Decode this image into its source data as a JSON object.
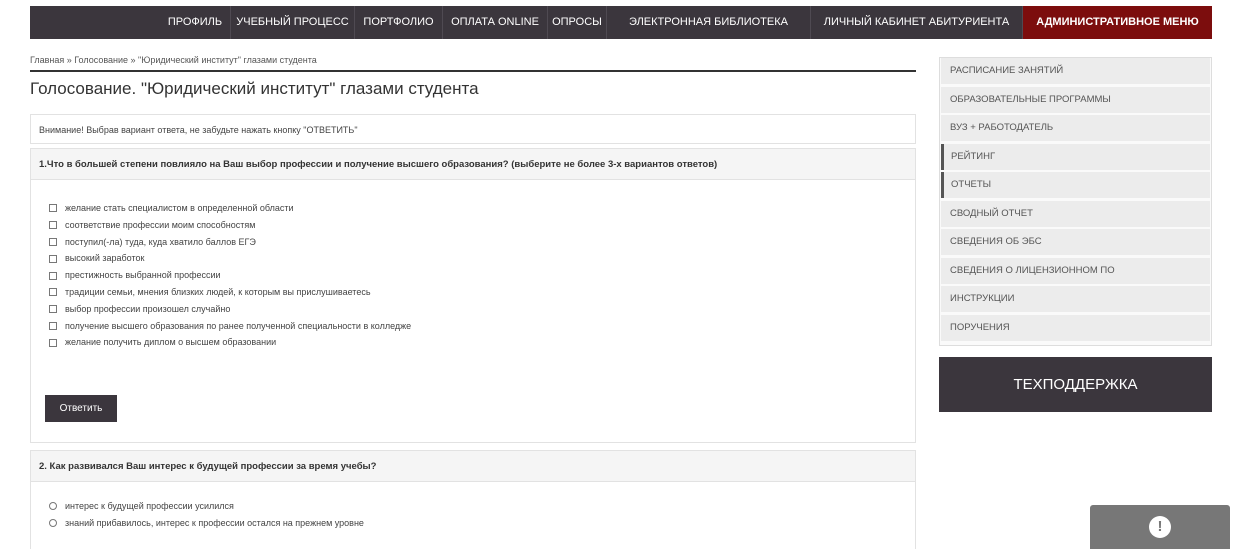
{
  "nav": {
    "items": [
      {
        "label": "Профиль"
      },
      {
        "label": "Учебный процесс"
      },
      {
        "label": "Портфолио"
      },
      {
        "label": "Оплата online"
      },
      {
        "label": "Опросы"
      },
      {
        "label": "Электронная библиотека"
      },
      {
        "label": "Личный кабинет абитуриента"
      },
      {
        "label": "Административное меню"
      }
    ]
  },
  "breadcrumb": {
    "home": "Главная",
    "sep": " » ",
    "voting": "Голосование",
    "current": "\"Юридический институт\" глазами студента"
  },
  "page": {
    "title": "Голосование. \"Юридический институт\" глазами студента",
    "notice": "Внимание! Выбрав вариант ответа, не забудьте нажать  кнопку \"ОТВЕТИТЬ\""
  },
  "question1": {
    "title": "1.Что в большей степени повлияло на Ваш выбор профессии и получение высшего образования? (выберите не более 3-х вариантов ответов)",
    "options": [
      "желание стать специалистом в определенной области",
      "соответствие профессии моим способностям",
      "поступил(-ла) туда, куда хватило баллов ЕГЭ",
      "высокий заработок",
      "престижность выбранной профессии",
      "традиции семьи, мнения близких людей, к которым вы прислушиваетесь",
      "выбор профессии произошел случайно",
      "получение высшего образования по ранее полученной специальности в колледже",
      "желание получить диплом о высшем образовании"
    ],
    "submit_label": "Ответить"
  },
  "question2": {
    "title": "2. Как развивался Ваш интерес к будущей профессии за время учебы?",
    "options": [
      "интерес к будущей профессии усилился",
      "знаний прибавилось, интерес к профессии остался на прежнем уровне"
    ]
  },
  "sidebar": {
    "items": [
      {
        "label": "Расписание занятий"
      },
      {
        "label": "Образовательные программы"
      },
      {
        "label": "ВУЗ + Работодатель"
      },
      {
        "label": "Рейтинг"
      },
      {
        "label": "Отчеты"
      },
      {
        "label": "Сводный отчет"
      },
      {
        "label": "Сведения об ЭБС"
      },
      {
        "label": "Сведения о лицензионном ПО"
      },
      {
        "label": "Инструкции"
      },
      {
        "label": "Поручения"
      }
    ]
  },
  "support": {
    "label": "Техподдержка"
  },
  "alert": {
    "glyph": "!"
  },
  "colors": {
    "nav_bg": "#3b363d",
    "active_nav": "#7c0d0d",
    "button": "#3b363d"
  }
}
